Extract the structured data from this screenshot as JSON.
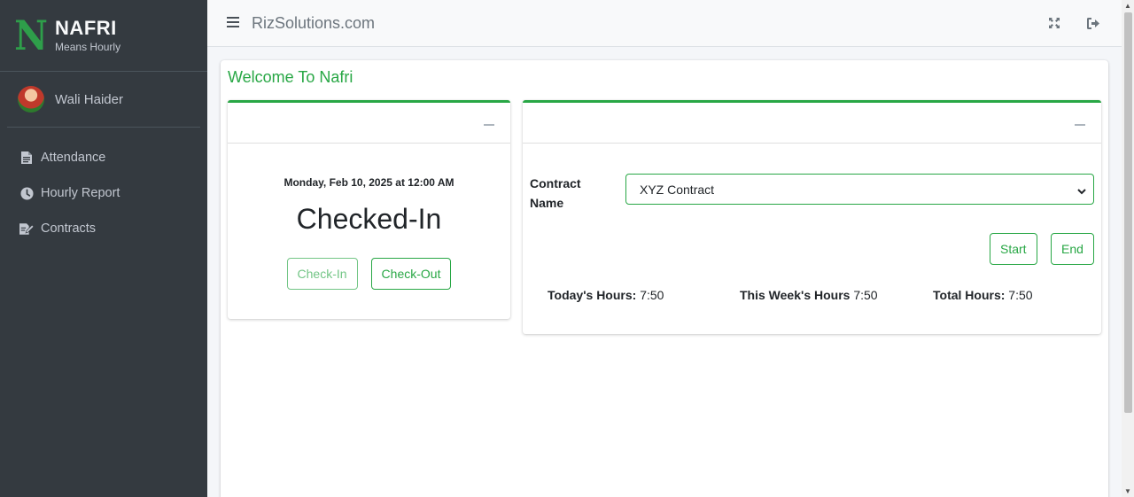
{
  "brand": {
    "logo_letter": "N",
    "name": "NAFRI",
    "tagline": "Means Hourly",
    "accent": "#28a745"
  },
  "user": {
    "name": "Wali Haider"
  },
  "sidebar": {
    "items": [
      {
        "label": "Attendance",
        "icon": "file-icon"
      },
      {
        "label": "Hourly Report",
        "icon": "clock-icon"
      },
      {
        "label": "Contracts",
        "icon": "edit-doc-icon"
      }
    ]
  },
  "topbar": {
    "title": "RizSolutions.com",
    "menu_icon": "hamburger-icon",
    "actions": [
      "expand-icon",
      "logout-icon"
    ]
  },
  "main": {
    "welcome": "Welcome To Nafri",
    "attendance": {
      "datetime": "Monday, Feb 10, 2025 at 12:00 AM",
      "status": "Checked-In",
      "checkin_label": "Check-In",
      "checkout_label": "Check-Out"
    },
    "contract": {
      "label": "Contract Name",
      "selected": "XYZ Contract",
      "start_label": "Start",
      "end_label": "End",
      "todays_label": "Today's Hours:",
      "todays_value": "7:50",
      "week_label": "This Week's Hours",
      "week_value": "7:50",
      "total_label": "Total Hours:",
      "total_value": "7:50"
    }
  }
}
